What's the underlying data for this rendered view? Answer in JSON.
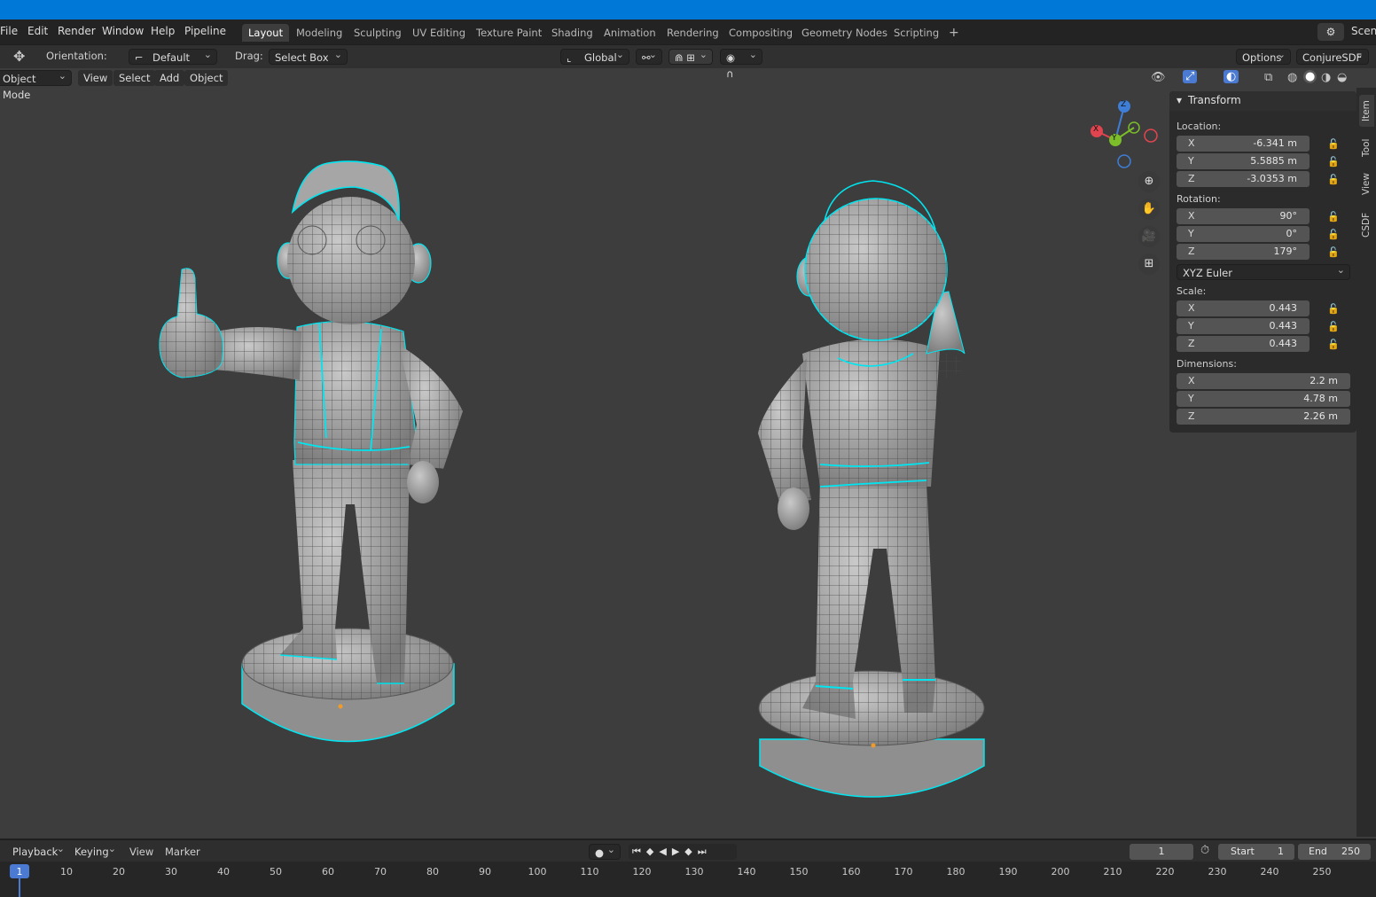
{
  "menu": [
    "File",
    "Edit",
    "Render",
    "Window",
    "Help",
    "Pipeline"
  ],
  "workspaces": [
    "Layout",
    "Modeling",
    "Sculpting",
    "UV Editing",
    "Texture Paint",
    "Shading",
    "Animation",
    "Rendering",
    "Compositing",
    "Geometry Nodes",
    "Scripting"
  ],
  "active_workspace": "Layout",
  "scene_label": "Scene",
  "tool_header": {
    "orientation_label": "Orientation:",
    "orientation_value": "Default",
    "drag_label": "Drag:",
    "drag_value": "Select Box",
    "transform_orientation": "Global",
    "options": "Options",
    "addon": "ConjureSDF"
  },
  "view_header": {
    "mode": "Object Mode",
    "menus": [
      "View",
      "Select",
      "Add",
      "Object"
    ]
  },
  "gizmo": {
    "x": "X",
    "y": "Y",
    "z": "Z"
  },
  "npanel": {
    "title": "Transform",
    "location_label": "Location:",
    "location": {
      "x": "-6.341 m",
      "y": "5.5885 m",
      "z": "-3.0353 m"
    },
    "rotation_label": "Rotation:",
    "rotation": {
      "x": "90°",
      "y": "0°",
      "z": "179°"
    },
    "rotation_mode": "XYZ Euler",
    "scale_label": "Scale:",
    "scale": {
      "x": "0.443",
      "y": "0.443",
      "z": "0.443"
    },
    "dimensions_label": "Dimensions:",
    "dimensions": {
      "x": "2.2 m",
      "y": "4.78 m",
      "z": "2.26 m"
    },
    "axis": {
      "x": "X",
      "y": "Y",
      "z": "Z"
    }
  },
  "side_tabs": [
    "Item",
    "Tool",
    "View",
    "CSDF"
  ],
  "timeline": {
    "playback": "Playback",
    "keying": "Keying",
    "view": "View",
    "marker": "Marker",
    "current_frame": "1",
    "start_label": "Start",
    "start": "1",
    "end_label": "End",
    "end": "250",
    "ruler": [
      "1",
      "10",
      "20",
      "30",
      "40",
      "50",
      "60",
      "70",
      "80",
      "90",
      "100",
      "110",
      "120",
      "130",
      "140",
      "150",
      "160",
      "170",
      "180",
      "190",
      "200",
      "210",
      "220",
      "230",
      "240",
      "250"
    ]
  },
  "colors": {
    "titlebar": "#0078d7",
    "selection_outline": "#00e5f0",
    "axis_x": "#e0454f",
    "axis_y": "#7cbd2a",
    "axis_z": "#3f7ed6",
    "frame_indicator": "#4a7ad1"
  }
}
